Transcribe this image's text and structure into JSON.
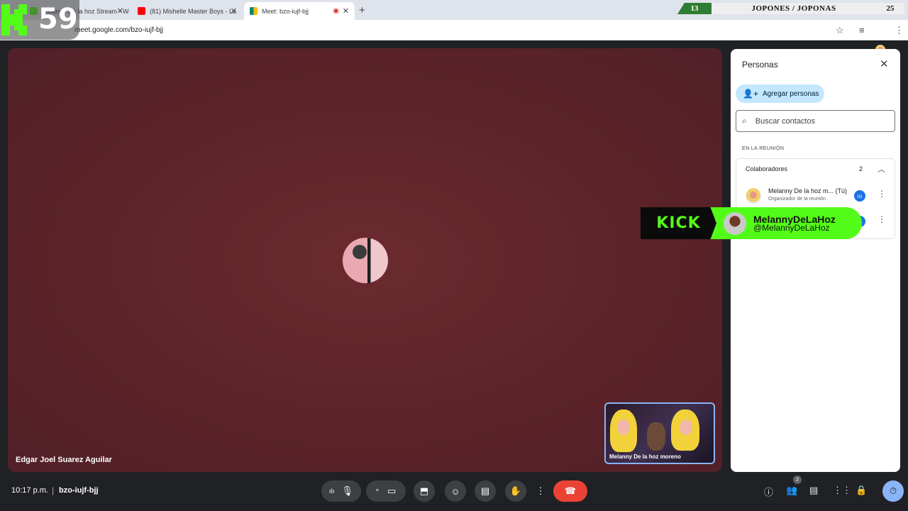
{
  "browser": {
    "tabs": [
      {
        "title": "Melanny De la hoz Stream - Watch",
        "color": "#53fc18"
      },
      {
        "title": "(81) Mishelle Master Boys - La",
        "color": "#ff0000"
      },
      {
        "title": "Meet: bzo-iujf-bjj",
        "color": "#00897b"
      }
    ],
    "url": "meet.google.com/bzo-iujf-bjj"
  },
  "overlays": {
    "score_left": "13",
    "score_title": "JOPONES / JOPONAS",
    "score_right": "25",
    "kick_counter": "59",
    "kick_brand": "KICK",
    "kick_name": "MelannyDeLaHoz",
    "kick_handle": "@MelannyDeLaHoz"
  },
  "stage": {
    "participant_name": "Edgar Joel Suarez Aguilar",
    "self_view_label": "Melanny De la hoz moreno",
    "background_color": "#5b2327"
  },
  "panel": {
    "title": "Personas",
    "add_people": "Agregar personas",
    "search_placeholder": "Buscar contactos",
    "section_label": "EN LA REUNIÓN",
    "group_label": "Colaboradores",
    "group_count": "2",
    "members": [
      {
        "name": "Melanny De la hoz m... (Tú)",
        "role": "Organizador de la reunión"
      }
    ]
  },
  "bottombar": {
    "time": "10:17 p.m.",
    "meeting_code": "bzo-iujf-bjj",
    "people_badge": "2"
  },
  "colors": {
    "accent": "#1a73e8",
    "end_call": "#ea4335",
    "kick_green": "#53fc18"
  }
}
